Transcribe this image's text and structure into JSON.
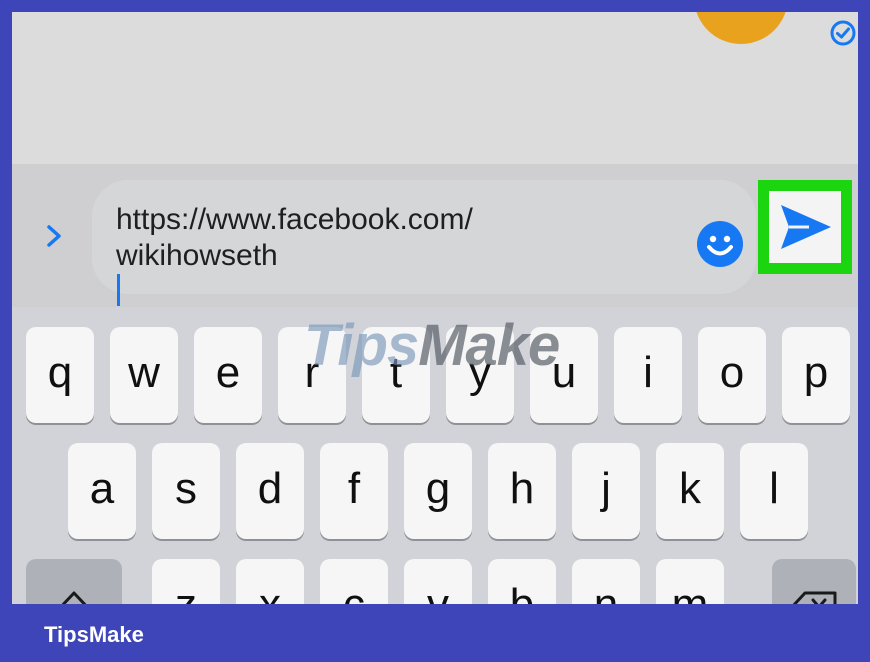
{
  "message_input": {
    "line1": "https://www.facebook.com/",
    "line2": "wikihowseth"
  },
  "icons": {
    "expand": "chevron-right-icon",
    "emoji": "emoji-icon",
    "send": "send-icon",
    "read_receipt": "check-circle-icon",
    "shift": "shift-icon",
    "backspace": "backspace-icon"
  },
  "keyboard": {
    "row1": [
      "q",
      "w",
      "e",
      "r",
      "t",
      "y",
      "u",
      "i",
      "o",
      "p"
    ],
    "row2": [
      "a",
      "s",
      "d",
      "f",
      "g",
      "h",
      "j",
      "k",
      "l"
    ],
    "row3": [
      "z",
      "x",
      "c",
      "v",
      "b",
      "n",
      "m"
    ]
  },
  "watermark": {
    "prefix": "Tips",
    "suffix": "Make"
  },
  "footer": {
    "brand": "TipsMake"
  },
  "colors": {
    "frame": "#3d45b8",
    "send_highlight": "#1bd60e",
    "accent_blue": "#1678f2",
    "avatar": "#e8a21e"
  }
}
